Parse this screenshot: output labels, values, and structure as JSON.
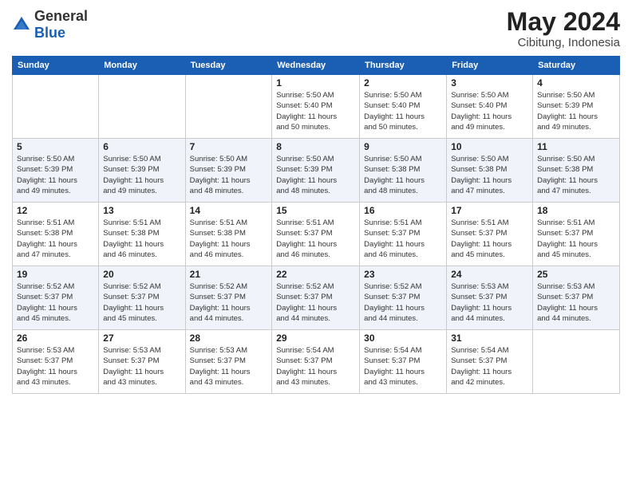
{
  "logo": {
    "text_general": "General",
    "text_blue": "Blue"
  },
  "header": {
    "month_year": "May 2024",
    "location": "Cibitung, Indonesia"
  },
  "weekdays": [
    "Sunday",
    "Monday",
    "Tuesday",
    "Wednesday",
    "Thursday",
    "Friday",
    "Saturday"
  ],
  "weeks": [
    [
      {
        "day": "",
        "info": ""
      },
      {
        "day": "",
        "info": ""
      },
      {
        "day": "",
        "info": ""
      },
      {
        "day": "1",
        "info": "Sunrise: 5:50 AM\nSunset: 5:40 PM\nDaylight: 11 hours\nand 50 minutes."
      },
      {
        "day": "2",
        "info": "Sunrise: 5:50 AM\nSunset: 5:40 PM\nDaylight: 11 hours\nand 50 minutes."
      },
      {
        "day": "3",
        "info": "Sunrise: 5:50 AM\nSunset: 5:40 PM\nDaylight: 11 hours\nand 49 minutes."
      },
      {
        "day": "4",
        "info": "Sunrise: 5:50 AM\nSunset: 5:39 PM\nDaylight: 11 hours\nand 49 minutes."
      }
    ],
    [
      {
        "day": "5",
        "info": "Sunrise: 5:50 AM\nSunset: 5:39 PM\nDaylight: 11 hours\nand 49 minutes."
      },
      {
        "day": "6",
        "info": "Sunrise: 5:50 AM\nSunset: 5:39 PM\nDaylight: 11 hours\nand 49 minutes."
      },
      {
        "day": "7",
        "info": "Sunrise: 5:50 AM\nSunset: 5:39 PM\nDaylight: 11 hours\nand 48 minutes."
      },
      {
        "day": "8",
        "info": "Sunrise: 5:50 AM\nSunset: 5:39 PM\nDaylight: 11 hours\nand 48 minutes."
      },
      {
        "day": "9",
        "info": "Sunrise: 5:50 AM\nSunset: 5:38 PM\nDaylight: 11 hours\nand 48 minutes."
      },
      {
        "day": "10",
        "info": "Sunrise: 5:50 AM\nSunset: 5:38 PM\nDaylight: 11 hours\nand 47 minutes."
      },
      {
        "day": "11",
        "info": "Sunrise: 5:50 AM\nSunset: 5:38 PM\nDaylight: 11 hours\nand 47 minutes."
      }
    ],
    [
      {
        "day": "12",
        "info": "Sunrise: 5:51 AM\nSunset: 5:38 PM\nDaylight: 11 hours\nand 47 minutes."
      },
      {
        "day": "13",
        "info": "Sunrise: 5:51 AM\nSunset: 5:38 PM\nDaylight: 11 hours\nand 46 minutes."
      },
      {
        "day": "14",
        "info": "Sunrise: 5:51 AM\nSunset: 5:38 PM\nDaylight: 11 hours\nand 46 minutes."
      },
      {
        "day": "15",
        "info": "Sunrise: 5:51 AM\nSunset: 5:37 PM\nDaylight: 11 hours\nand 46 minutes."
      },
      {
        "day": "16",
        "info": "Sunrise: 5:51 AM\nSunset: 5:37 PM\nDaylight: 11 hours\nand 46 minutes."
      },
      {
        "day": "17",
        "info": "Sunrise: 5:51 AM\nSunset: 5:37 PM\nDaylight: 11 hours\nand 45 minutes."
      },
      {
        "day": "18",
        "info": "Sunrise: 5:51 AM\nSunset: 5:37 PM\nDaylight: 11 hours\nand 45 minutes."
      }
    ],
    [
      {
        "day": "19",
        "info": "Sunrise: 5:52 AM\nSunset: 5:37 PM\nDaylight: 11 hours\nand 45 minutes."
      },
      {
        "day": "20",
        "info": "Sunrise: 5:52 AM\nSunset: 5:37 PM\nDaylight: 11 hours\nand 45 minutes."
      },
      {
        "day": "21",
        "info": "Sunrise: 5:52 AM\nSunset: 5:37 PM\nDaylight: 11 hours\nand 44 minutes."
      },
      {
        "day": "22",
        "info": "Sunrise: 5:52 AM\nSunset: 5:37 PM\nDaylight: 11 hours\nand 44 minutes."
      },
      {
        "day": "23",
        "info": "Sunrise: 5:52 AM\nSunset: 5:37 PM\nDaylight: 11 hours\nand 44 minutes."
      },
      {
        "day": "24",
        "info": "Sunrise: 5:53 AM\nSunset: 5:37 PM\nDaylight: 11 hours\nand 44 minutes."
      },
      {
        "day": "25",
        "info": "Sunrise: 5:53 AM\nSunset: 5:37 PM\nDaylight: 11 hours\nand 44 minutes."
      }
    ],
    [
      {
        "day": "26",
        "info": "Sunrise: 5:53 AM\nSunset: 5:37 PM\nDaylight: 11 hours\nand 43 minutes."
      },
      {
        "day": "27",
        "info": "Sunrise: 5:53 AM\nSunset: 5:37 PM\nDaylight: 11 hours\nand 43 minutes."
      },
      {
        "day": "28",
        "info": "Sunrise: 5:53 AM\nSunset: 5:37 PM\nDaylight: 11 hours\nand 43 minutes."
      },
      {
        "day": "29",
        "info": "Sunrise: 5:54 AM\nSunset: 5:37 PM\nDaylight: 11 hours\nand 43 minutes."
      },
      {
        "day": "30",
        "info": "Sunrise: 5:54 AM\nSunset: 5:37 PM\nDaylight: 11 hours\nand 43 minutes."
      },
      {
        "day": "31",
        "info": "Sunrise: 5:54 AM\nSunset: 5:37 PM\nDaylight: 11 hours\nand 42 minutes."
      },
      {
        "day": "",
        "info": ""
      }
    ]
  ]
}
